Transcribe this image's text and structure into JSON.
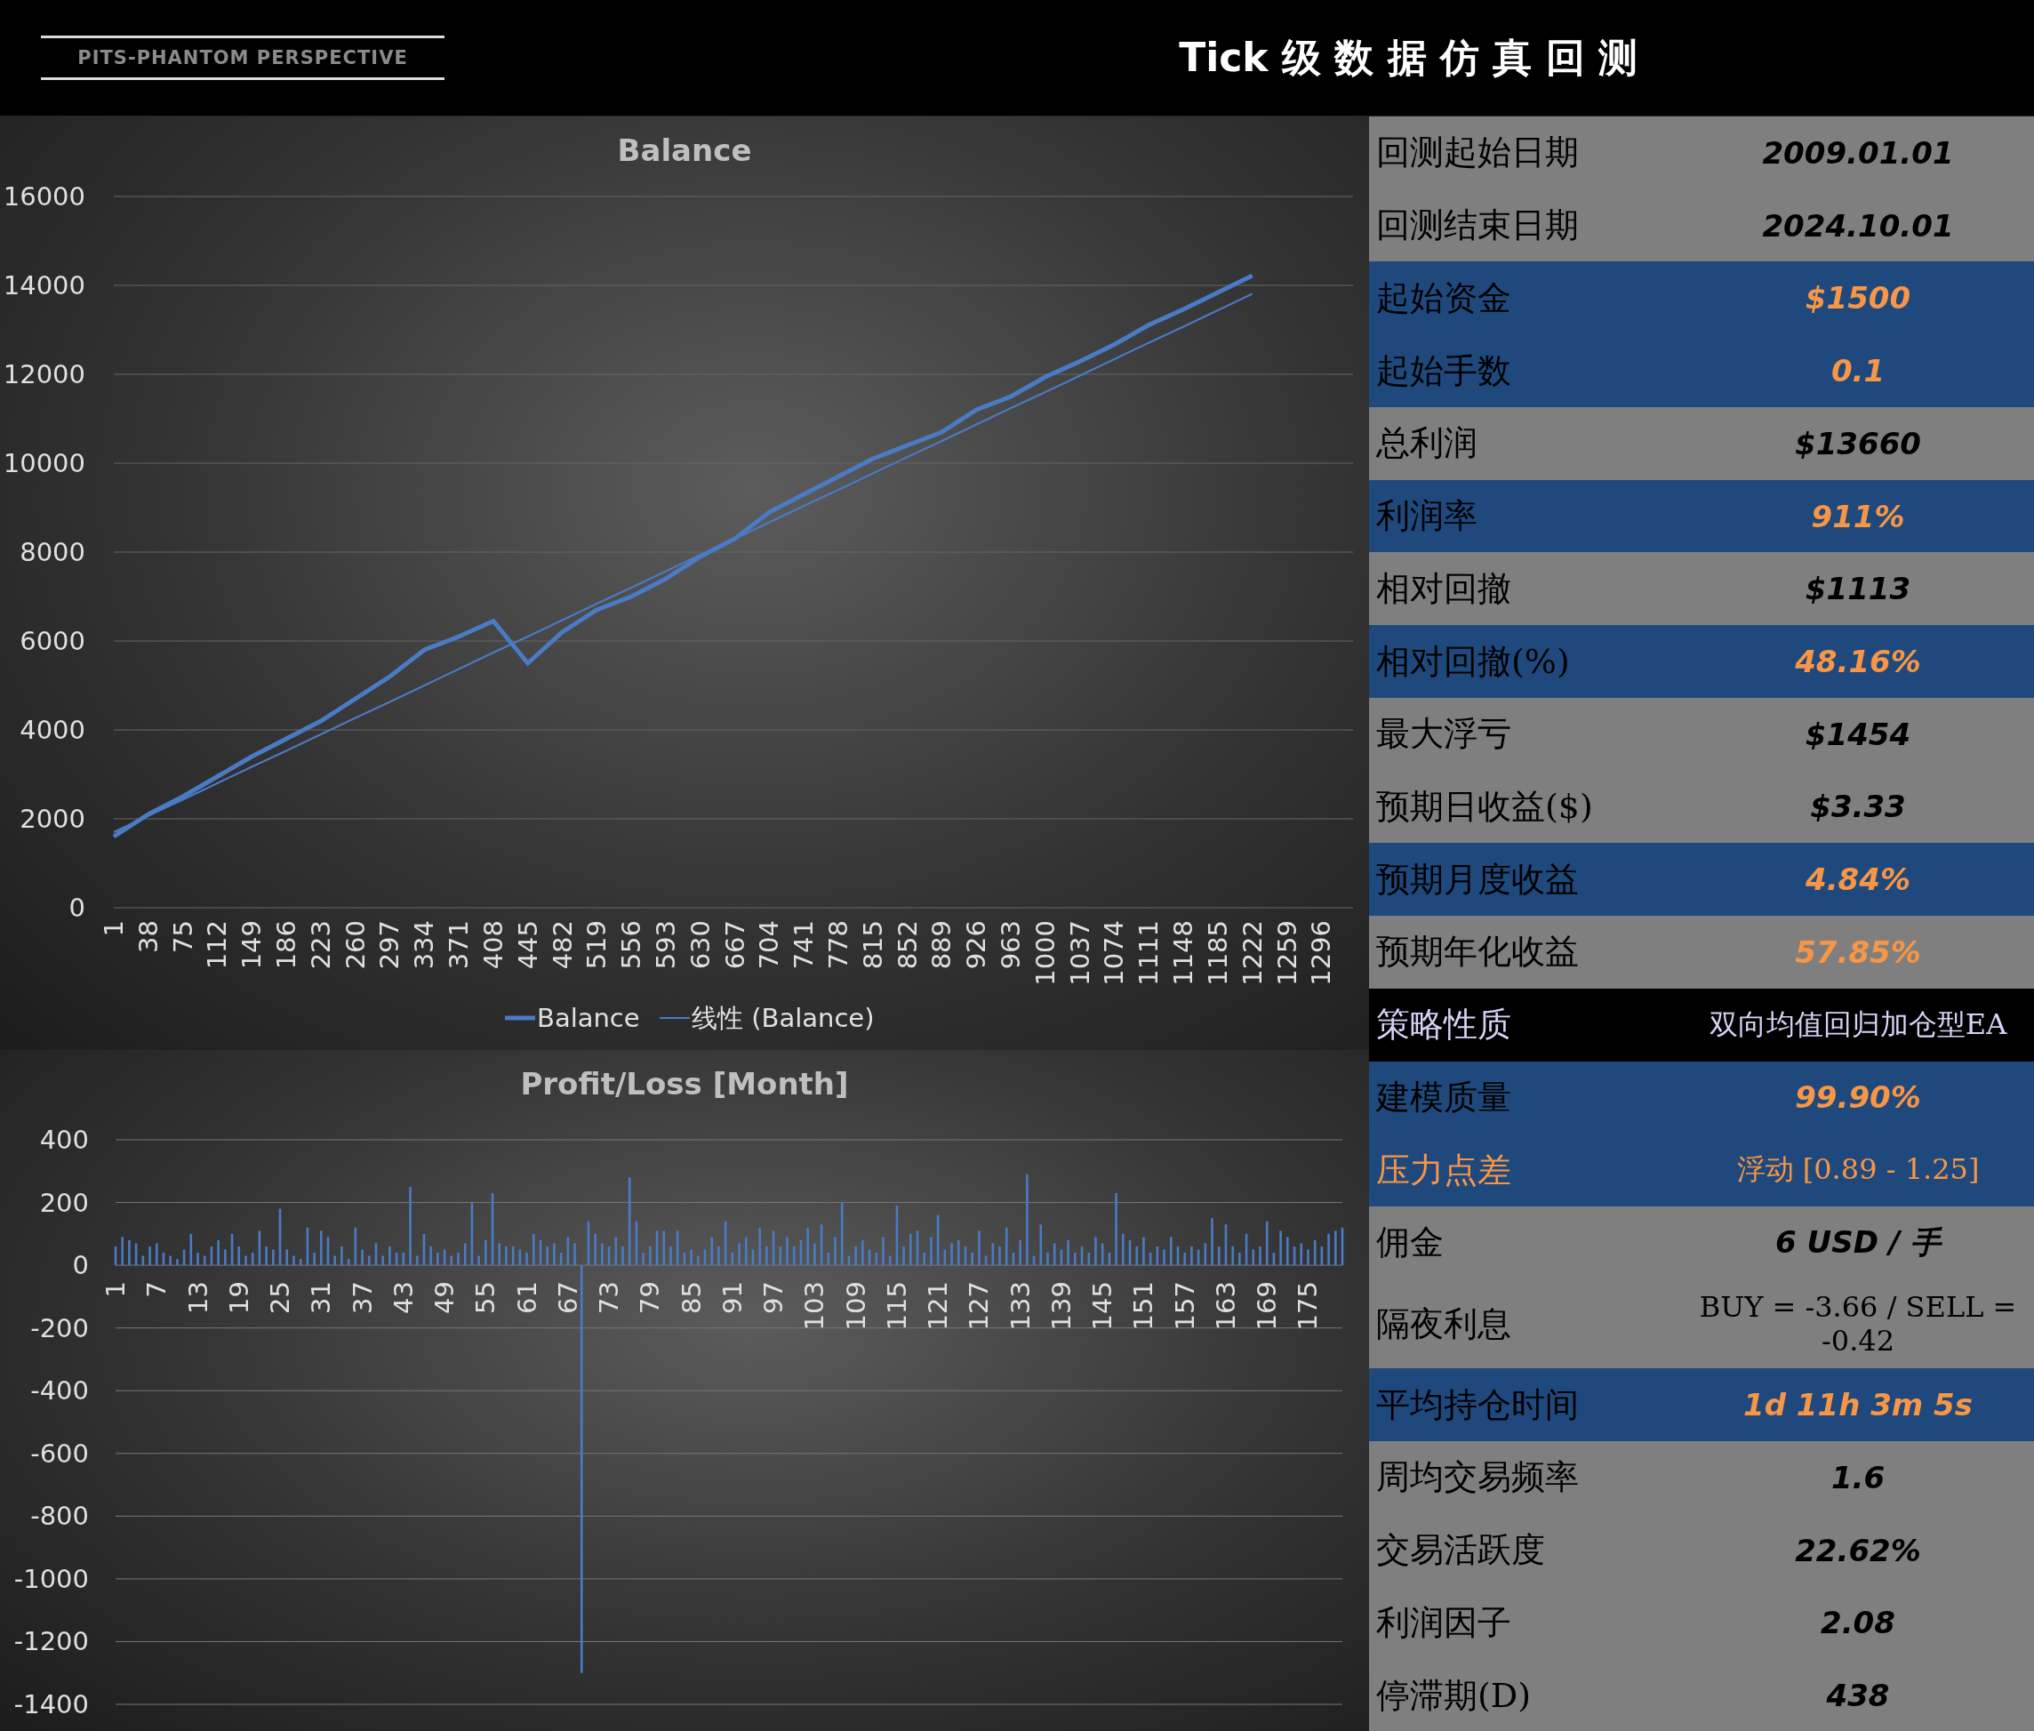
{
  "header": {
    "brand": "PITS-PHANTOM PERSPECTIVE",
    "title": "Tick 级 数 据 仿 真 回 测"
  },
  "balance_chart": {
    "chart_data": {
      "type": "line",
      "title": "Balance",
      "x": [
        1,
        38,
        75,
        112,
        149,
        186,
        223,
        260,
        297,
        334,
        371,
        408,
        445,
        482,
        519,
        556,
        593,
        630,
        667,
        704,
        741,
        778,
        815,
        852,
        889,
        926,
        963,
        1000,
        1037,
        1074,
        1111,
        1148,
        1185,
        1222
      ],
      "series": [
        {
          "name": "Balance",
          "color": "#4a7bc4",
          "values": [
            1600,
            2100,
            2500,
            2950,
            3400,
            3800,
            4200,
            4700,
            5200,
            5800,
            6100,
            6450,
            5500,
            6200,
            6700,
            7000,
            7400,
            7900,
            8300,
            8900,
            9300,
            9700,
            10100,
            10400,
            10700,
            11200,
            11500,
            11940,
            12290,
            12670,
            13110,
            13460,
            13840,
            14220
          ]
        },
        {
          "name": "线性 (Balance)",
          "color": "#4a7bc4",
          "values": [
            1700,
            2070,
            2430,
            2800,
            3170,
            3530,
            3900,
            4270,
            4630,
            5000,
            5370,
            5740,
            6100,
            6470,
            6840,
            7200,
            7570,
            7940,
            8300,
            8670,
            9040,
            9400,
            9770,
            10140,
            10500,
            10870,
            11240,
            11600,
            11970,
            12340,
            12710,
            13070,
            13440,
            13810
          ]
        }
      ],
      "xlim": [
        1,
        1330
      ],
      "ylim": [
        0,
        16000
      ],
      "xticks": [
        1,
        38,
        75,
        112,
        149,
        186,
        223,
        260,
        297,
        334,
        371,
        408,
        445,
        482,
        519,
        556,
        593,
        630,
        667,
        704,
        741,
        778,
        815,
        852,
        889,
        926,
        963,
        1000,
        1037,
        1074,
        1111,
        1148,
        1185,
        1222,
        1259,
        1296
      ],
      "yticks": [
        0,
        2000,
        4000,
        6000,
        8000,
        10000,
        12000,
        14000,
        16000
      ],
      "grid": true,
      "legend": "bottom"
    }
  },
  "pl_chart": {
    "chart_data": {
      "type": "bar",
      "title": "Profit/Loss [Month]",
      "x": [
        1,
        2,
        3,
        4,
        5,
        6,
        7,
        8,
        9,
        10,
        11,
        12,
        13,
        14,
        15,
        16,
        17,
        18,
        19,
        20,
        21,
        22,
        23,
        24,
        25,
        26,
        27,
        28,
        29,
        30,
        31,
        32,
        33,
        34,
        35,
        36,
        37,
        38,
        39,
        40,
        41,
        42,
        43,
        44,
        45,
        46,
        47,
        48,
        49,
        50,
        51,
        52,
        53,
        54,
        55,
        56,
        57,
        58,
        59,
        60,
        61,
        62,
        63,
        64,
        65,
        66,
        67,
        68,
        69,
        70,
        71,
        72,
        73,
        74,
        75,
        76,
        77,
        78,
        79,
        80,
        81,
        82,
        83,
        84,
        85,
        86,
        87,
        88,
        89,
        90,
        91,
        92,
        93,
        94,
        95,
        96,
        97,
        98,
        99,
        100,
        101,
        102,
        103,
        104,
        105,
        106,
        107,
        108,
        109,
        110,
        111,
        112,
        113,
        114,
        115,
        116,
        117,
        118,
        119,
        120,
        121,
        122,
        123,
        124,
        125,
        126,
        127,
        128,
        129,
        130,
        131,
        132,
        133,
        134,
        135,
        136,
        137,
        138,
        139,
        140,
        141,
        142,
        143,
        144,
        145,
        146,
        147,
        148,
        149,
        150,
        151,
        152,
        153,
        154,
        155,
        156,
        157,
        158,
        159,
        160,
        161,
        162,
        163,
        164,
        165,
        166,
        167,
        168,
        169,
        170,
        171,
        172,
        173,
        174,
        175,
        176,
        177,
        178,
        179,
        180
      ],
      "series": [
        {
          "color": "#4a7bc4",
          "values": [
            60,
            90,
            80,
            70,
            30,
            60,
            70,
            40,
            30,
            20,
            50,
            100,
            40,
            30,
            60,
            80,
            50,
            100,
            60,
            30,
            40,
            110,
            60,
            50,
            180,
            50,
            30,
            20,
            120,
            40,
            110,
            90,
            30,
            60,
            20,
            120,
            50,
            30,
            70,
            30,
            60,
            40,
            40,
            250,
            30,
            100,
            60,
            40,
            50,
            30,
            40,
            70,
            200,
            30,
            80,
            230,
            70,
            60,
            60,
            50,
            40,
            100,
            80,
            60,
            70,
            40,
            90,
            70,
            -1300,
            140,
            100,
            70,
            60,
            90,
            60,
            280,
            140,
            40,
            60,
            110,
            110,
            60,
            110,
            40,
            50,
            30,
            50,
            90,
            60,
            140,
            40,
            70,
            90,
            50,
            120,
            60,
            110,
            60,
            90,
            60,
            80,
            120,
            70,
            130,
            40,
            90,
            200,
            30,
            60,
            80,
            50,
            40,
            90,
            30,
            190,
            60,
            100,
            110,
            40,
            90,
            160,
            50,
            70,
            80,
            60,
            40,
            110,
            30,
            70,
            60,
            120,
            40,
            80,
            290,
            30,
            130,
            40,
            70,
            50,
            80,
            40,
            60,
            40,
            90,
            70,
            40,
            230,
            100,
            80,
            60,
            90,
            40,
            60,
            50,
            90,
            60,
            40,
            60,
            50,
            70,
            150,
            60,
            130,
            60,
            40,
            100,
            50,
            60,
            140,
            40,
            110,
            90,
            60,
            70,
            50,
            80,
            60,
            100,
            110,
            120
          ]
        }
      ],
      "xlim": [
        1,
        180
      ],
      "ylim": [
        -1400,
        400
      ],
      "xticks": [
        1,
        7,
        13,
        19,
        25,
        31,
        37,
        43,
        49,
        55,
        61,
        67,
        73,
        79,
        85,
        91,
        97,
        103,
        109,
        115,
        121,
        127,
        133,
        139,
        145,
        151,
        157,
        163,
        169,
        175
      ],
      "yticks": [
        -1400,
        -1200,
        -1000,
        -800,
        -600,
        -400,
        -200,
        0,
        200,
        400
      ],
      "grid": true
    }
  },
  "stats": [
    {
      "label": "回测起始日期",
      "value": "2009.01.01",
      "kind": "gray",
      "label_accent": false,
      "value_accent": false
    },
    {
      "label": "回测结束日期",
      "value": "2024.10.01",
      "kind": "gray",
      "label_accent": false,
      "value_accent": false
    },
    {
      "label": "起始资金",
      "value": "$1500",
      "kind": "blue",
      "label_accent": false,
      "value_accent": true
    },
    {
      "label": "起始手数",
      "value": "0.1",
      "kind": "blue",
      "label_accent": false,
      "value_accent": true
    },
    {
      "label": "总利润",
      "value": "$13660",
      "kind": "gray",
      "label_accent": false,
      "value_accent": false
    },
    {
      "label": "利润率",
      "value": "911%",
      "kind": "blue",
      "label_accent": false,
      "value_accent": true
    },
    {
      "label": "相对回撤",
      "value": "$1113",
      "kind": "gray",
      "label_accent": false,
      "value_accent": false
    },
    {
      "label": "相对回撤(%)",
      "value": "48.16%",
      "kind": "blue",
      "label_accent": false,
      "value_accent": true
    },
    {
      "label": "最大浮亏",
      "value": "$1454",
      "kind": "gray",
      "label_accent": false,
      "value_accent": false
    },
    {
      "label": "预期日收益($)",
      "value": "$3.33",
      "kind": "gray",
      "label_accent": false,
      "value_accent": false
    },
    {
      "label": "预期月度收益",
      "value": "4.84%",
      "kind": "blue",
      "label_accent": false,
      "value_accent": true
    },
    {
      "label": "预期年化收益",
      "value": "57.85%",
      "kind": "gray",
      "label_accent": false,
      "value_accent": true
    },
    {
      "label": "策略性质",
      "value": "双向均值回归加仓型EA",
      "kind": "black",
      "label_accent": false,
      "value_accent": false
    },
    {
      "label": "建模质量",
      "value": "99.90%",
      "kind": "blue",
      "label_accent": false,
      "value_accent": true
    },
    {
      "label": "压力点差",
      "value": "浮动 [0.89 - 1.25]",
      "kind": "blue",
      "label_accent": true,
      "value_accent": true
    },
    {
      "label": "佣金",
      "value": "6 USD / 手",
      "kind": "gray",
      "label_accent": false,
      "value_accent": false
    },
    {
      "label": "隔夜利息",
      "value": "BUY = -3.66 / SELL = -0.42",
      "kind": "gray",
      "label_accent": false,
      "value_accent": false
    },
    {
      "label": "平均持仓时间",
      "value": "1d 11h 3m 5s",
      "kind": "blue",
      "label_accent": false,
      "value_accent": true
    },
    {
      "label": "周均交易频率",
      "value": "1.6",
      "kind": "gray",
      "label_accent": false,
      "value_accent": false
    },
    {
      "label": "交易活跃度",
      "value": "22.62%",
      "kind": "gray",
      "label_accent": false,
      "value_accent": false
    },
    {
      "label": "利润因子",
      "value": "2.08",
      "kind": "gray",
      "label_accent": false,
      "value_accent": false
    },
    {
      "label": "停滞期(D)",
      "value": "438",
      "kind": "gray",
      "label_accent": false,
      "value_accent": false
    }
  ]
}
